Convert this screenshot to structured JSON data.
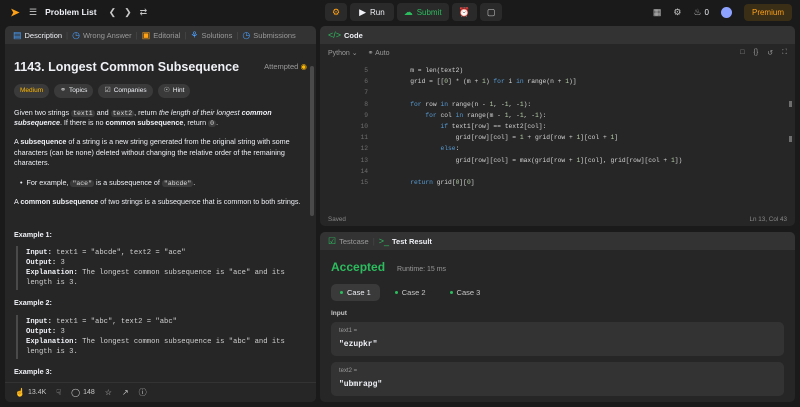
{
  "topbar": {
    "problem_list": "Problem List",
    "run": "Run",
    "submit": "Submit",
    "coins": "0",
    "premium": "Premium"
  },
  "left_tabs": [
    "Description",
    "Wrong Answer",
    "Editorial",
    "Solutions",
    "Submissions"
  ],
  "problem": {
    "title": "1143. Longest Common Subsequence",
    "status": "Attempted",
    "chips": [
      "Medium",
      "Topics",
      "Companies",
      "Hint"
    ],
    "p1_a": "Given two strings ",
    "p1_t1": "text1",
    "p1_and": " and ",
    "p1_t2": "text2",
    "p1_b": ", return ",
    "p1_em": "the length of their longest ",
    "p1_em_b": "common subsequence",
    "p1_c": ". If there is no ",
    "p1_cs": "common subsequence",
    "p1_d": ", return ",
    "p1_zero": "0",
    "p1_e": ".",
    "p2_b": "subsequence",
    "p2_rest": " of a string is a new string generated from the original string with some characters (can be none) deleted without changing the relative order of the remaining characters.",
    "p2_a": "A ",
    "bullet_a": "For example, ",
    "bullet_c1": "\"ace\"",
    "bullet_mid": " is a subsequence of ",
    "bullet_c2": "\"abcde\"",
    "bullet_end": ".",
    "p3_a": "A ",
    "p3_b": "common subsequence",
    "p3_rest": " of two strings is a subsequence that is common to both strings.",
    "ex1_h": "Example 1:",
    "ex1_in_k": "Input:",
    "ex1_in": " text1 = \"abcde\", text2 = \"ace\"",
    "ex1_out_k": "Output:",
    "ex1_out": " 3",
    "ex1_exp_k": "Explanation:",
    "ex1_exp": " The longest common subsequence is \"ace\" and its length is 3.",
    "ex2_h": "Example 2:",
    "ex2_in_k": "Input:",
    "ex2_in": " text1 = \"abc\", text2 = \"abc\"",
    "ex2_out_k": "Output:",
    "ex2_out": " 3",
    "ex2_exp_k": "Explanation:",
    "ex2_exp": " The longest common subsequence is \"abc\" and its length is 3.",
    "ex3_h": "Example 3:"
  },
  "footer": {
    "likes": "13.4K",
    "comments": "148"
  },
  "code_panel": {
    "title": "Code",
    "language": "Python",
    "mode": "Auto",
    "saved": "Saved",
    "cursor": "Ln 13, Col 43",
    "lines": [
      {
        "n": "5",
        "t": "        m = len(text2)"
      },
      {
        "n": "6",
        "t": "        grid = [[0] * (m + 1) for i in range(n + 1)]"
      },
      {
        "n": "7",
        "t": ""
      },
      {
        "n": "8",
        "t": "        for row in range(n - 1, -1, -1):"
      },
      {
        "n": "9",
        "t": "            for col in range(m - 1, -1, -1):"
      },
      {
        "n": "10",
        "t": "                if text1[row] == text2[col]:"
      },
      {
        "n": "11",
        "t": "                    grid[row][col] = 1 + grid[row + 1][col + 1]"
      },
      {
        "n": "12",
        "t": "                else:"
      },
      {
        "n": "13",
        "t": "                    grid[row][col] = max(grid[row + 1][col], grid[row][col + 1])"
      },
      {
        "n": "14",
        "t": ""
      },
      {
        "n": "15",
        "t": "        return grid[0][0]"
      }
    ]
  },
  "result_panel": {
    "tab_testcase": "Testcase",
    "tab_result": "Test Result",
    "status": "Accepted",
    "runtime": "Runtime: 15 ms",
    "cases": [
      "Case 1",
      "Case 2",
      "Case 3"
    ],
    "input_label": "Input",
    "inputs": [
      {
        "key": "text1 =",
        "value": "\"ezupkr\""
      },
      {
        "key": "text2 =",
        "value": "\"ubmrapg\""
      }
    ]
  },
  "colors": {
    "accent": "#ffa116",
    "success": "#2cbb5d",
    "medium": "#ffb800"
  }
}
